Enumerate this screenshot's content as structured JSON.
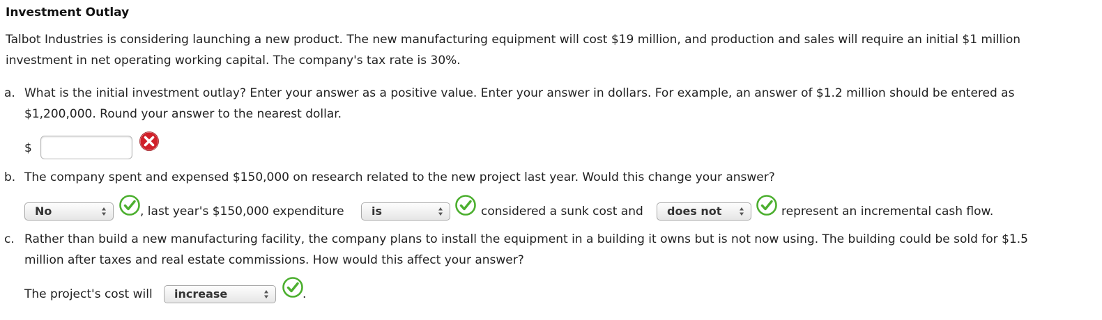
{
  "title": "Investment Outlay",
  "intro": {
    "line1": "Talbot Industries is considering launching a new product. The new manufacturing equipment will cost $19 million, and production and sales will require an initial $1 million",
    "line2": "investment in net operating working capital. The company's tax rate is 30%."
  },
  "question_a": {
    "letter": "a.",
    "line1": "What is the initial investment outlay? Enter your answer as a positive value. Enter your answer in dollars. For example, an answer of $1.2 million should be entered as",
    "line2": "$1,200,000. Round your answer to the nearest dollar.",
    "currency_symbol": "$",
    "answer_value": "",
    "status_icon": "incorrect-x-icon"
  },
  "question_b": {
    "letter": "b.",
    "text": "The company spent and expensed $150,000 on research related to the new project last year. Would this change your answer?",
    "select1": "No",
    "text2": ", last year's $150,000 expenditure",
    "select2": "is",
    "text3": "considered a sunk cost and",
    "select3": "does not",
    "text4": "represent an incremental cash flow.",
    "status_icon": "correct-check-icon"
  },
  "question_c": {
    "letter": "c.",
    "line1": "Rather than build a new manufacturing facility, the company plans to install the equipment in a building it owns but is not now using. The building could be sold for $1.5",
    "line2": "million after taxes and real estate commissions. How would this affect your answer?",
    "prefix": "The project's cost will",
    "select": "increase",
    "suffix": ".",
    "status_icon": "correct-check-icon"
  },
  "colors": {
    "correct": "#4caf2f",
    "incorrect": "#d0202a"
  }
}
